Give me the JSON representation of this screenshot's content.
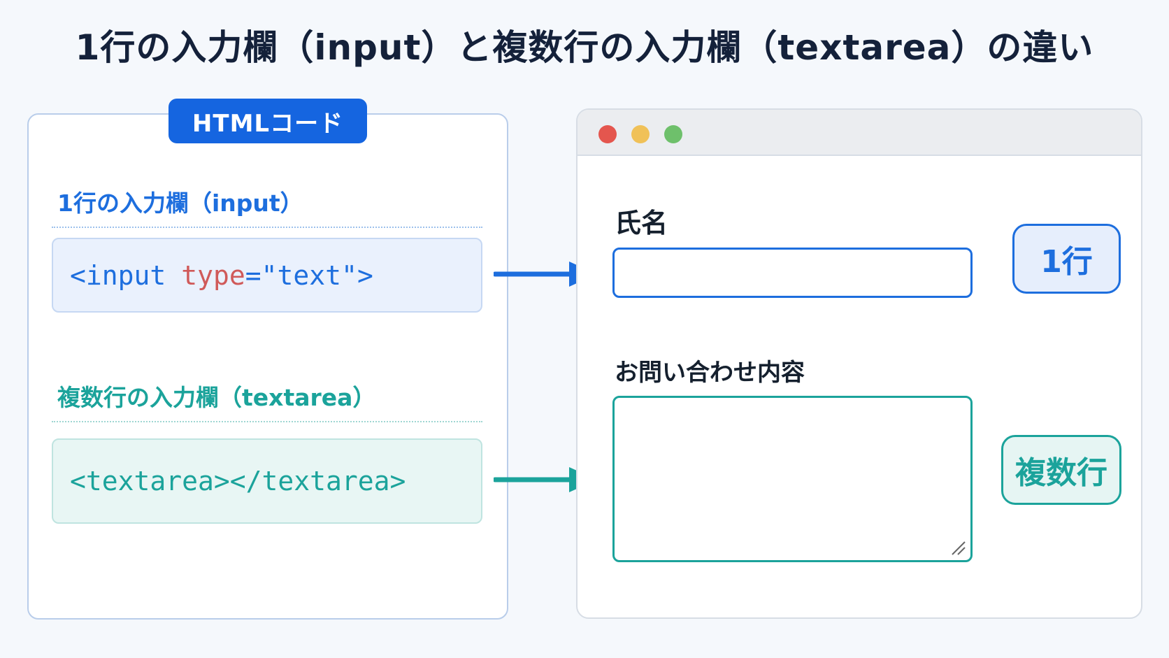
{
  "title": "1行の入力欄（input）と複数行の入力欄（textarea）の違い",
  "code_panel": {
    "tag": "HTMLコード",
    "input_section": {
      "heading": "1行の入力欄（input）",
      "code_tag_open": "<input",
      "code_attr": "type",
      "code_rest": "=\"text\">"
    },
    "textarea_section": {
      "heading": "複数行の入力欄（textarea）",
      "code": "<textarea></textarea>"
    }
  },
  "browser": {
    "name_label": "氏名",
    "inquiry_label": "お問い合わせ内容",
    "name_value": "",
    "inquiry_value": ""
  },
  "badges": {
    "single": "1行",
    "multi": "複数行"
  },
  "colors": {
    "input_accent": "#1d6ede",
    "textarea_accent": "#1ba39b",
    "attr_color": "#d05a5a",
    "tag_bg": "#1565e0"
  },
  "icons": {
    "arrow_input": "arrow-right-icon",
    "arrow_textarea": "arrow-right-icon",
    "resize": "resize-grip-icon"
  }
}
